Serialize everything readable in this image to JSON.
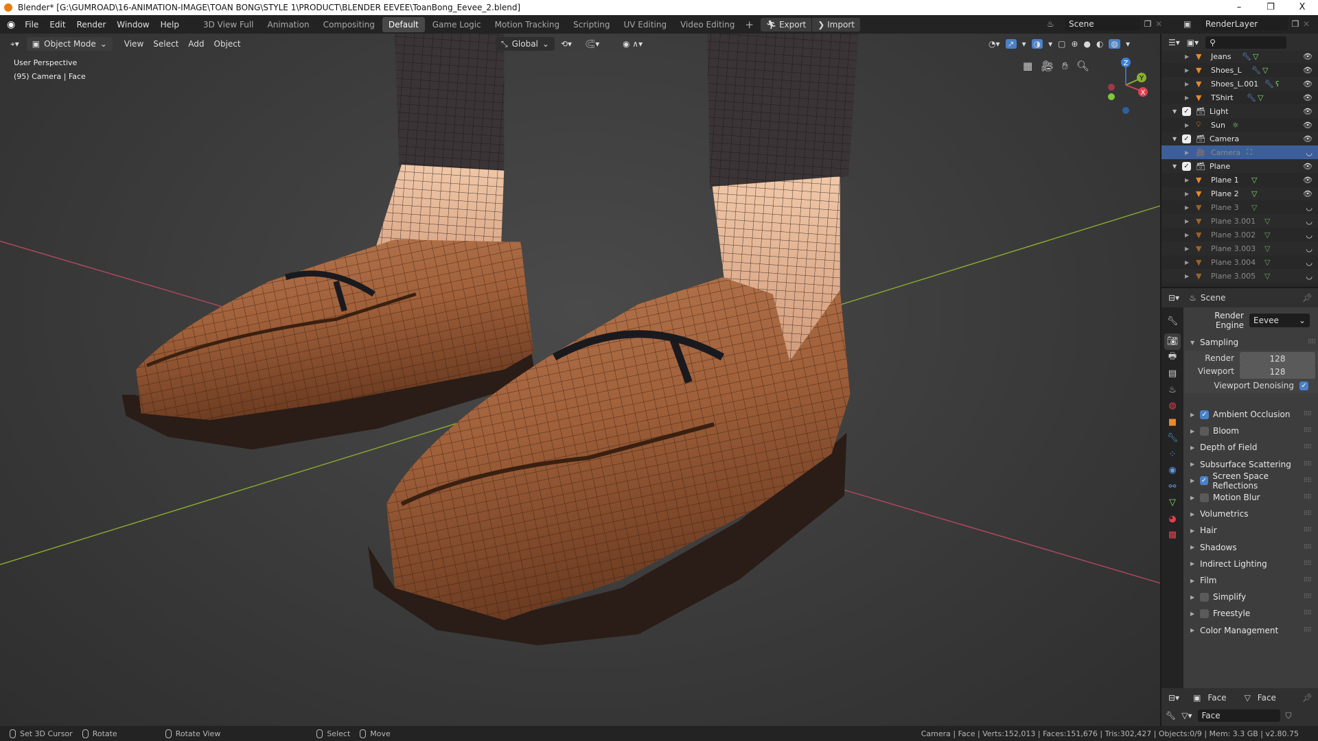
{
  "title_bar": {
    "title": "Blender* [G:\\GUMROAD\\16-ANIMATION-IMAGE\\TOAN BONG\\STYLE 1\\PRODUCT\\BLENDER EEVEE\\ToanBong_Eevee_2.blend]",
    "minimize": "–",
    "maximize": "❐",
    "close": "X"
  },
  "menu": [
    "File",
    "Edit",
    "Render",
    "Window",
    "Help"
  ],
  "workspaces": [
    {
      "label": "3D View Full",
      "active": false
    },
    {
      "label": "Animation",
      "active": false
    },
    {
      "label": "Compositing",
      "active": false
    },
    {
      "label": "Default",
      "active": true
    },
    {
      "label": "Game Logic",
      "active": false
    },
    {
      "label": "Motion Tracking",
      "active": false
    },
    {
      "label": "Scripting",
      "active": false
    },
    {
      "label": "UV Editing",
      "active": false
    },
    {
      "label": "Video Editing",
      "active": false
    }
  ],
  "add_workspace": "+",
  "export_label": "Export",
  "import_label": "Import",
  "scene_name": "Scene",
  "view_layer": "RenderLayer",
  "viewport": {
    "mode": "Object Mode",
    "menus": [
      "View",
      "Select",
      "Add",
      "Object"
    ],
    "orientation": "Global",
    "perspective": "User Perspective",
    "info": "(95) Camera | Face",
    "gizmo": {
      "x": "X",
      "y": "Y",
      "z": "Z"
    }
  },
  "outliner": [
    {
      "name": "Jeans",
      "type": "mesh",
      "indent": 2,
      "mods": [
        "wrench",
        "mesh"
      ],
      "visible": true
    },
    {
      "name": "Shoes_L",
      "type": "mesh",
      "indent": 2,
      "mods": [
        "wrench",
        "mesh"
      ],
      "visible": true
    },
    {
      "name": "Shoes_L.001",
      "type": "mesh",
      "indent": 2,
      "mods": [
        "wrench",
        "curve"
      ],
      "visible": true
    },
    {
      "name": "TShirt",
      "type": "mesh",
      "indent": 2,
      "mods": [
        "wrench",
        "mesh"
      ],
      "visible": true
    },
    {
      "name": "Light",
      "type": "collection",
      "indent": 1,
      "mods": [],
      "visible": true
    },
    {
      "name": "Sun",
      "type": "light",
      "indent": 2,
      "mods": [
        "sun"
      ],
      "visible": true
    },
    {
      "name": "Camera",
      "type": "collection",
      "indent": 1,
      "mods": [],
      "visible": true
    },
    {
      "name": "Camera",
      "type": "camera",
      "indent": 2,
      "mods": [
        "camera"
      ],
      "visible": false,
      "selected": true
    },
    {
      "name": "Plane",
      "type": "collection",
      "indent": 1,
      "mods": [],
      "visible": true
    },
    {
      "name": "Plane 1",
      "type": "mesh",
      "indent": 2,
      "mods": [
        "mesh"
      ],
      "visible": true
    },
    {
      "name": "Plane 2",
      "type": "mesh",
      "indent": 2,
      "mods": [
        "mesh"
      ],
      "visible": true
    },
    {
      "name": "Plane 3",
      "type": "mesh",
      "indent": 2,
      "mods": [
        "mesh"
      ],
      "visible": false
    },
    {
      "name": "Plane 3.001",
      "type": "mesh",
      "indent": 2,
      "mods": [
        "mesh"
      ],
      "visible": false
    },
    {
      "name": "Plane 3.002",
      "type": "mesh",
      "indent": 2,
      "mods": [
        "mesh"
      ],
      "visible": false
    },
    {
      "name": "Plane 3.003",
      "type": "mesh",
      "indent": 2,
      "mods": [
        "mesh"
      ],
      "visible": false
    },
    {
      "name": "Plane 3.004",
      "type": "mesh",
      "indent": 2,
      "mods": [
        "mesh"
      ],
      "visible": false
    },
    {
      "name": "Plane 3.005",
      "type": "mesh",
      "indent": 2,
      "mods": [
        "mesh"
      ],
      "visible": false
    }
  ],
  "properties": {
    "context": "Scene",
    "render_engine_label": "Render Engine",
    "render_engine": "Eevee",
    "sampling_label": "Sampling",
    "render_label": "Render",
    "render_samples": "128",
    "viewport_label": "Viewport",
    "viewport_samples": "128",
    "denoising_label": "Viewport Denoising",
    "denoising": true,
    "panels": [
      {
        "label": "Ambient Occlusion",
        "checkbox": true,
        "checked": true
      },
      {
        "label": "Bloom",
        "checkbox": true,
        "checked": false
      },
      {
        "label": "Depth of Field",
        "checkbox": false
      },
      {
        "label": "Subsurface Scattering",
        "checkbox": false
      },
      {
        "label": "Screen Space Reflections",
        "checkbox": true,
        "checked": true
      },
      {
        "label": "Motion Blur",
        "checkbox": true,
        "checked": false
      },
      {
        "label": "Volumetrics",
        "checkbox": false
      },
      {
        "label": "Hair",
        "checkbox": false
      },
      {
        "label": "Shadows",
        "checkbox": false
      },
      {
        "label": "Indirect Lighting",
        "checkbox": false
      },
      {
        "label": "Film",
        "checkbox": false
      },
      {
        "label": "Simplify",
        "checkbox": true,
        "checked": false
      },
      {
        "label": "Freestyle",
        "checkbox": true,
        "checked": false
      },
      {
        "label": "Color Management",
        "checkbox": false
      }
    ],
    "tabs": [
      "tool",
      "render",
      "output",
      "view-layer",
      "scene",
      "world",
      "object",
      "modifiers",
      "particles",
      "physics",
      "constraints",
      "data",
      "material",
      "texture"
    ]
  },
  "bottom_props": {
    "object": "Face",
    "data": "Face",
    "mesh_name": "Face"
  },
  "status": {
    "hints": [
      "Set 3D Cursor",
      "Rotate",
      "Rotate View",
      "Select",
      "Move"
    ],
    "stats": "Camera | Face | Verts:152,013 | Faces:151,676 | Tris:302,427 | Objects:0/9 | Mem: 3.3 GB | v2.80.75"
  },
  "colors": {
    "accent": "#4a80c8",
    "selection": "#3c5f9a",
    "object_orange": "#e8892c",
    "mesh_green": "#7ee06a",
    "axis_x": "#c0506a",
    "axis_y": "#8ab030"
  }
}
